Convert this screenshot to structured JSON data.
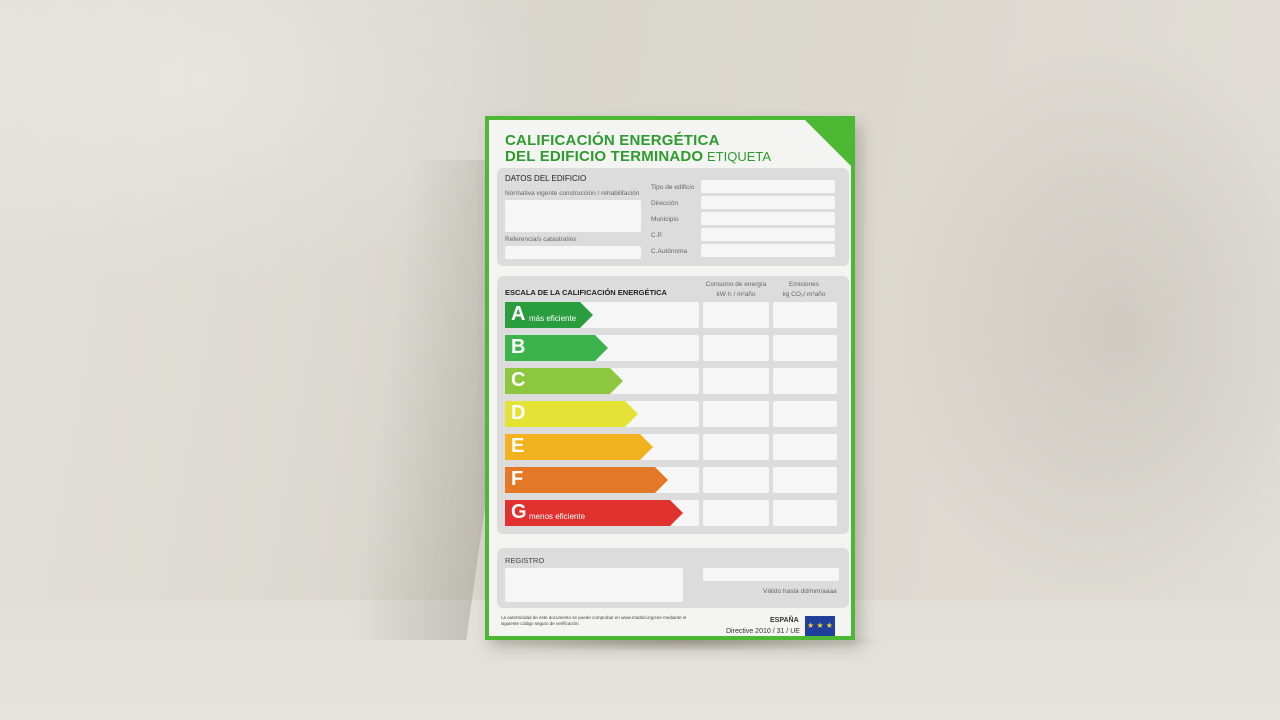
{
  "title_line1": "CALIFICACIÓN ENERGÉTICA",
  "title_line2": "DEL EDIFICIO TERMINADO",
  "tag": "ETIQUETA",
  "datos": {
    "heading": "DATOS DEL EDIFICIO",
    "normativa": "Normativa vigente construcción / rehabilitación",
    "referencia": "Referencia/s catastral/es",
    "fields": [
      "Tipo de edificio",
      "Dirección",
      "Municipio",
      "C.P.",
      "C.Autónoma"
    ]
  },
  "escala": {
    "heading": "ESCALA DE LA CALIFICACIÓN ENERGÉTICA",
    "col1_line1": "Consumo de energía",
    "col1_line2": "kW·h / m²año",
    "col2_line1": "Emisiones",
    "col2_line2": "kg CO₂/ m²año",
    "ratings": [
      {
        "letter": "A",
        "desc": "más eficiente",
        "color": "#2a9d3f"
      },
      {
        "letter": "B",
        "desc": "",
        "color": "#3cb44b"
      },
      {
        "letter": "C",
        "desc": "",
        "color": "#8dc63f"
      },
      {
        "letter": "D",
        "desc": "",
        "color": "#e3e235"
      },
      {
        "letter": "E",
        "desc": "",
        "color": "#f2b21f"
      },
      {
        "letter": "F",
        "desc": "",
        "color": "#e37926"
      },
      {
        "letter": "G",
        "desc": "menos eficiente",
        "color": "#e0312f"
      }
    ]
  },
  "registro": {
    "heading": "REGISTRO",
    "valido": "Válido hasta dd/mm/aaaa"
  },
  "footer": {
    "note": "La autenticidad de este documento se puede comprobar en www.madrid.org/cee mediante el siguiente código seguro de verificación.",
    "country": "ESPAÑA",
    "directive": "Directive 2010 / 31 / UE",
    "eu_stars": "★ ★ ★"
  }
}
